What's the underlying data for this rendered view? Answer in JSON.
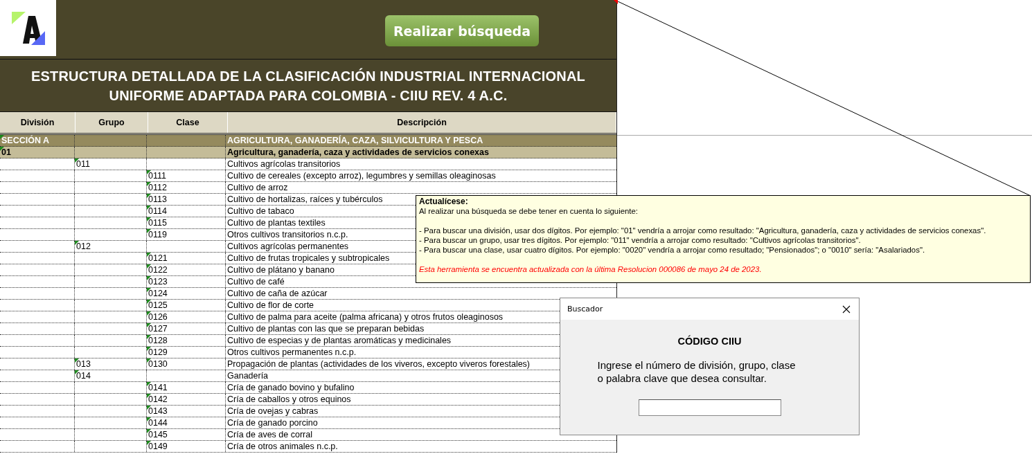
{
  "header": {
    "search_button": "Realizar búsqueda"
  },
  "title_lines": [
    "ESTRUCTURA DETALLADA DE LA CLASIFICACIÓN INDUSTRIAL INTERNACIONAL",
    "UNIFORME ADAPTADA PARA COLOMBIA - CIIU REV. 4 A.C."
  ],
  "table": {
    "columns": [
      "División",
      "Grupo",
      "Clase",
      "Descripción"
    ],
    "rows": [
      {
        "kind": "section",
        "division": "SECCIÓN A",
        "description": "AGRICULTURA, GANADERÍA, CAZA, SILVICULTURA Y PESCA"
      },
      {
        "kind": "division",
        "division": "01",
        "description": "Agricultura, ganadería, caza y actividades de servicios conexas"
      },
      {
        "kind": "item",
        "group": "011",
        "description": "Cultivos agrícolas transitorios"
      },
      {
        "kind": "item",
        "class": "0111",
        "description": "Cultivo de cereales (excepto arroz), legumbres y semillas oleaginosas"
      },
      {
        "kind": "item",
        "class": "0112",
        "description": "Cultivo de arroz"
      },
      {
        "kind": "item",
        "class": "0113",
        "description": "Cultivo de hortalizas, raíces y tubérculos"
      },
      {
        "kind": "item",
        "class": "0114",
        "description": "Cultivo de tabaco"
      },
      {
        "kind": "item",
        "class": "0115",
        "description": "Cultivo de plantas textiles"
      },
      {
        "kind": "item",
        "class": "0119",
        "description": "Otros cultivos transitorios n.c.p."
      },
      {
        "kind": "item",
        "group": "012",
        "description": "Cultivos agrícolas permanentes"
      },
      {
        "kind": "item",
        "class": "0121",
        "description": "Cultivo de frutas tropicales y subtropicales"
      },
      {
        "kind": "item",
        "class": "0122",
        "description": "Cultivo de plátano y banano"
      },
      {
        "kind": "item",
        "class": "0123",
        "description": "Cultivo de café"
      },
      {
        "kind": "item",
        "class": "0124",
        "description": "Cultivo de caña de azúcar"
      },
      {
        "kind": "item",
        "class": "0125",
        "description": "Cultivo de flor de corte"
      },
      {
        "kind": "item",
        "class": "0126",
        "description": "Cultivo de palma para aceite (palma africana) y otros frutos oleaginosos"
      },
      {
        "kind": "item",
        "class": "0127",
        "description": "Cultivo de plantas con las que se preparan bebidas"
      },
      {
        "kind": "item",
        "class": "0128",
        "description": "Cultivo de especias y de plantas aromáticas y medicinales"
      },
      {
        "kind": "item",
        "class": "0129",
        "description": "Otros cultivos permanentes n.c.p."
      },
      {
        "kind": "item",
        "group": "013",
        "class": "0130",
        "description": "Propagación de plantas (actividades de los viveros, excepto viveros forestales)"
      },
      {
        "kind": "item",
        "group": "014",
        "description": "Ganadería"
      },
      {
        "kind": "item",
        "class": "0141",
        "description": "Cría de ganado bovino y bufalino"
      },
      {
        "kind": "item",
        "class": "0142",
        "description": "Cría de caballos y otros equinos"
      },
      {
        "kind": "item",
        "class": "0143",
        "description": "Cría de ovejas y cabras"
      },
      {
        "kind": "item",
        "class": "0144",
        "description": "Cría de ganado porcino"
      },
      {
        "kind": "item",
        "class": "0145",
        "description": "Cría de aves de corral"
      },
      {
        "kind": "item",
        "class": "0149",
        "description": "Cría de otros animales n.c.p."
      }
    ]
  },
  "comment": {
    "author": "Actualícese:",
    "intro": "Al realizar una búsqueda se debe tener en cuenta lo siguiente:",
    "lines": [
      "- Para buscar una división, usar dos dígitos. Por ejemplo: \"01\" vendría a arrojar como resultado: \"Agricultura, ganadería, caza y actividades de servicios conexas\".",
      "- Para buscar un grupo, usar tres dígitos. Por ejemplo: \"011\" vendría a arrojar como resultado: \"Cultivos agrícolas transitorios\".",
      "- Para buscar una clase, usar cuatro dígitos. Por ejemplo: \"0020\" vendría a arrojar como resultado; \"Pensionados\"; o \"0010\" sería: \"Asalariados\"."
    ],
    "note": "Esta herramienta se encuentra actualizada con la última Resolucion 000086 de mayo 24 de 2023."
  },
  "dialog": {
    "title": "Buscador",
    "heading": "CÓDIGO CIIU",
    "prompt_lines": [
      "Ingrese el número de división, grupo, clase",
      "o palabra clave que desea consultar."
    ]
  }
}
